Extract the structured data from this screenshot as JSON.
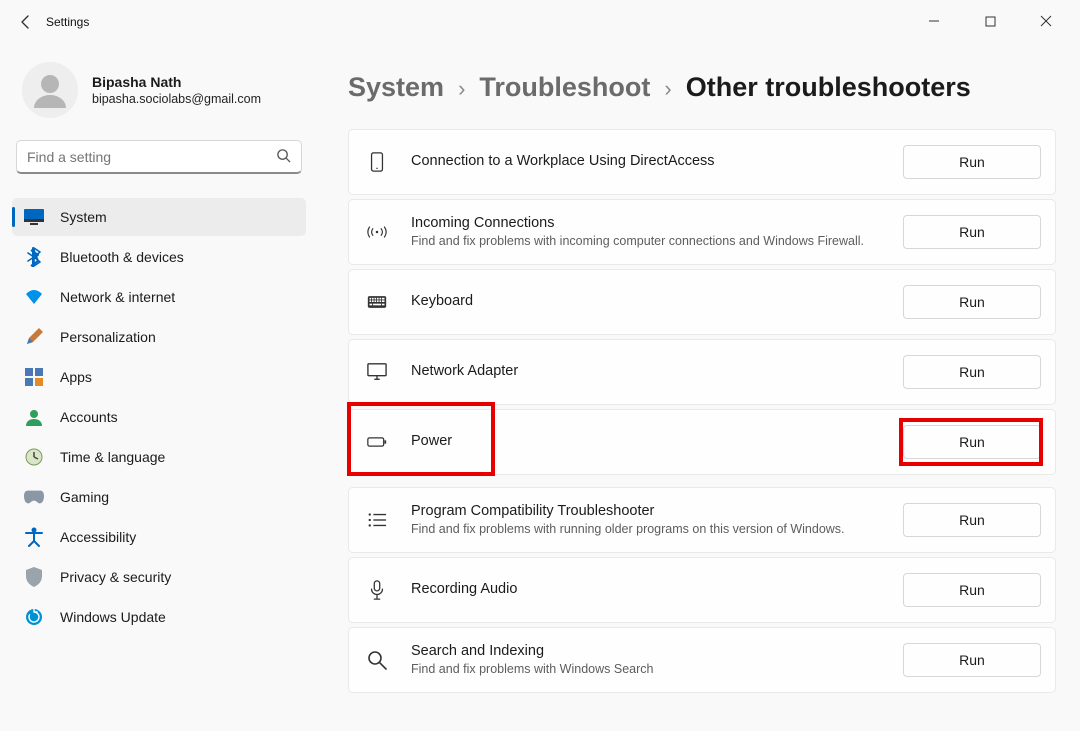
{
  "window": {
    "title": "Settings"
  },
  "account": {
    "name": "Bipasha Nath",
    "email": "bipasha.sociolabs@gmail.com"
  },
  "search": {
    "placeholder": "Find a setting"
  },
  "sidebar": {
    "items": [
      {
        "label": "System",
        "active": true
      },
      {
        "label": "Bluetooth & devices"
      },
      {
        "label": "Network & internet"
      },
      {
        "label": "Personalization"
      },
      {
        "label": "Apps"
      },
      {
        "label": "Accounts"
      },
      {
        "label": "Time & language"
      },
      {
        "label": "Gaming"
      },
      {
        "label": "Accessibility"
      },
      {
        "label": "Privacy & security"
      },
      {
        "label": "Windows Update"
      }
    ]
  },
  "breadcrumb": {
    "a": "System",
    "b": "Troubleshoot",
    "c": "Other troubleshooters"
  },
  "troubleshooters": [
    {
      "title": "Connection to a Workplace Using DirectAccess",
      "desc": "",
      "run": "Run"
    },
    {
      "title": "Incoming Connections",
      "desc": "Find and fix problems with incoming computer connections and Windows Firewall.",
      "run": "Run"
    },
    {
      "title": "Keyboard",
      "desc": "",
      "run": "Run"
    },
    {
      "title": "Network Adapter",
      "desc": "",
      "run": "Run"
    },
    {
      "title": "Power",
      "desc": "",
      "run": "Run"
    },
    {
      "title": "Program Compatibility Troubleshooter",
      "desc": "Find and fix problems with running older programs on this version of Windows.",
      "run": "Run"
    },
    {
      "title": "Recording Audio",
      "desc": "",
      "run": "Run"
    },
    {
      "title": "Search and Indexing",
      "desc": "Find and fix problems with Windows Search",
      "run": "Run"
    }
  ],
  "highlight": {
    "power_group": true,
    "power_run": true
  }
}
